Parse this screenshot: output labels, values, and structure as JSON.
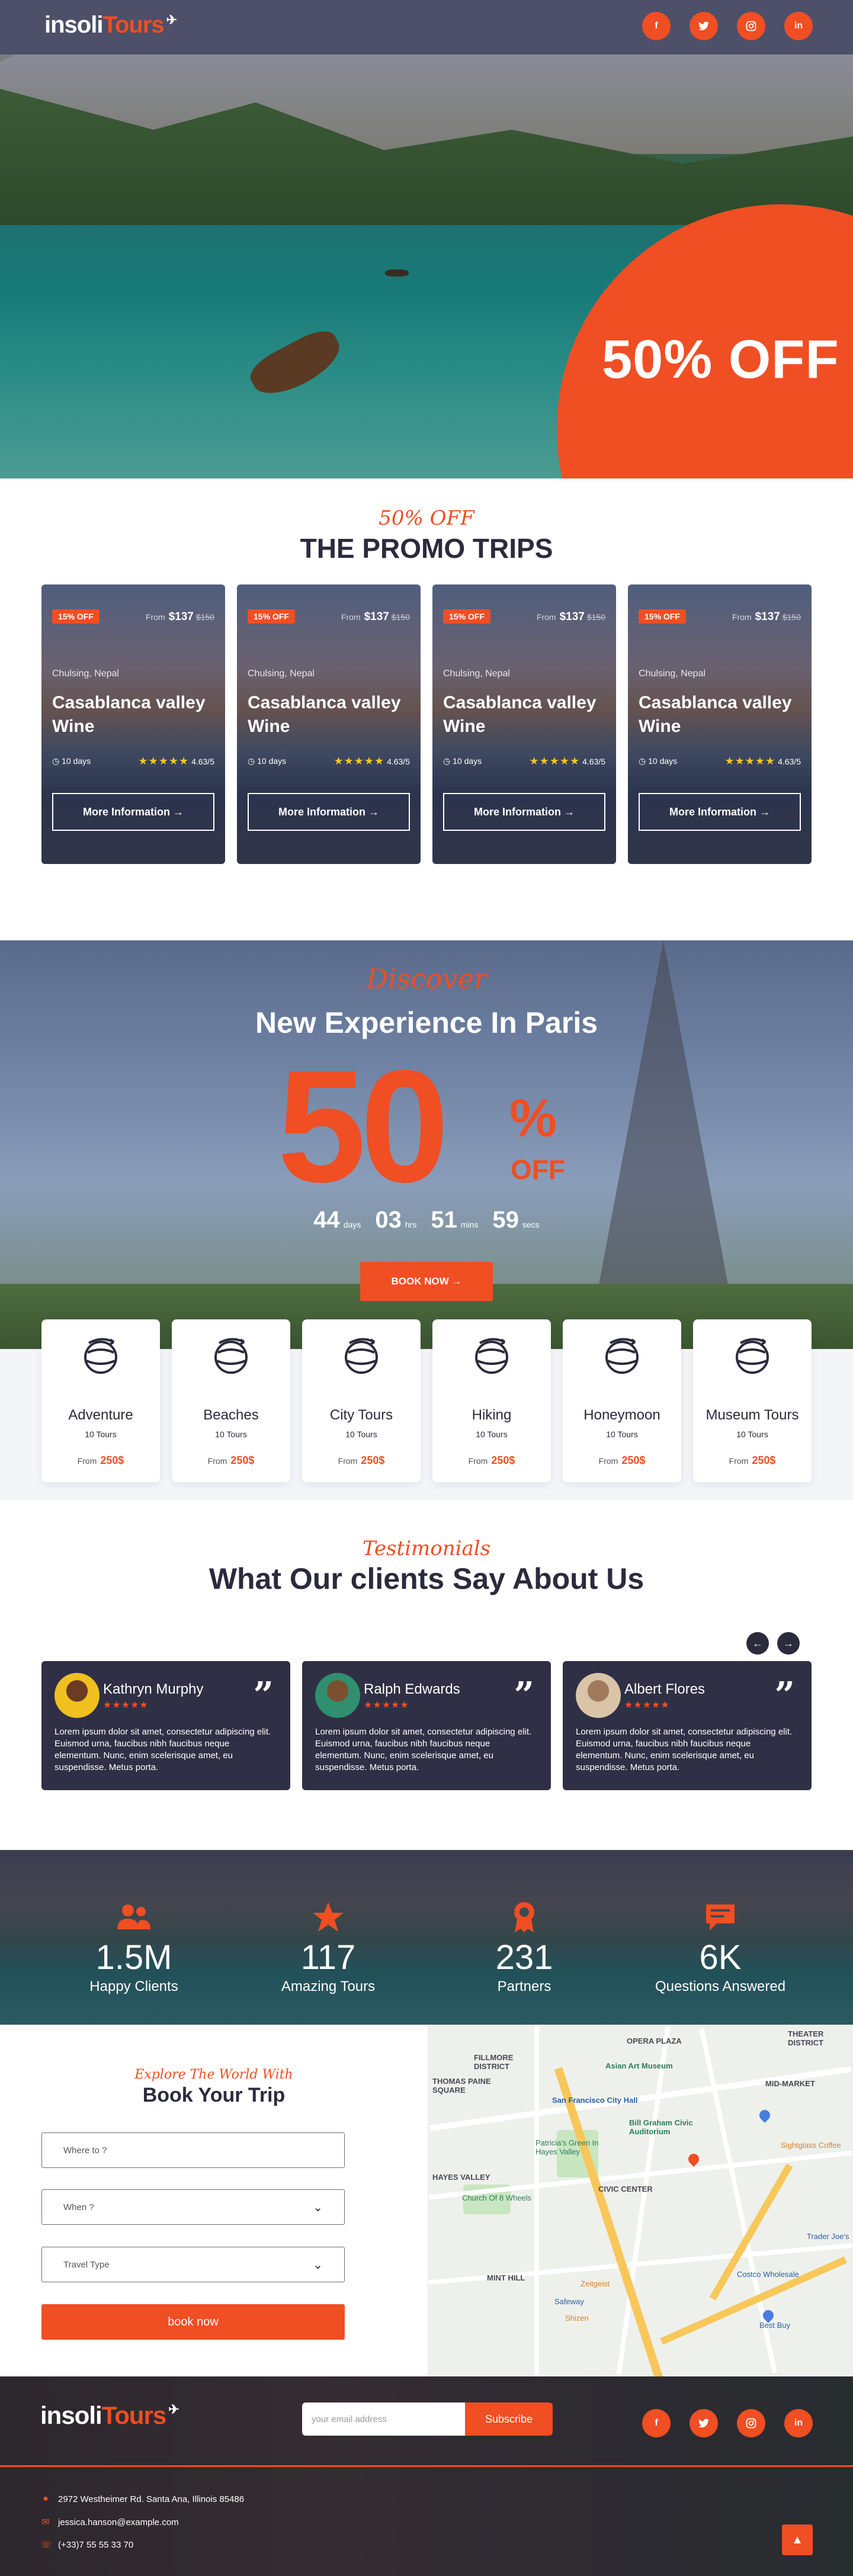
{
  "header": {
    "logo_part1": "insoli",
    "logo_part2": "Tours",
    "socials": [
      "f",
      "t",
      "ig",
      "in"
    ]
  },
  "hero": {
    "offer": "50% OFF"
  },
  "promo": {
    "script": "50% OFF",
    "title": "THE PROMO TRIPS",
    "cards": [
      {
        "badge": "15% OFF",
        "from": "From",
        "price": "$137",
        "old_price": "$150",
        "location": "Chulsing, Nepal",
        "title": "Casablanca valley Wine",
        "duration": "10 days",
        "rating": "4.63/5",
        "button": "More Information →"
      },
      {
        "badge": "15% OFF",
        "from": "From",
        "price": "$137",
        "old_price": "$150",
        "location": "Chulsing, Nepal",
        "title": "Casablanca valley Wine",
        "duration": "10 days",
        "rating": "4.63/5",
        "button": "More Information →"
      },
      {
        "badge": "15% OFF",
        "from": "From",
        "price": "$137",
        "old_price": "$150",
        "location": "Chulsing, Nepal",
        "title": "Casablanca valley Wine",
        "duration": "10 days",
        "rating": "4.63/5",
        "button": "More Information →"
      },
      {
        "badge": "15% OFF",
        "from": "From",
        "price": "$137",
        "old_price": "$150",
        "location": "Chulsing, Nepal",
        "title": "Casablanca valley Wine",
        "duration": "10 days",
        "rating": "4.63/5",
        "button": "More Information →"
      }
    ]
  },
  "paris": {
    "script": "Discover",
    "title": "New Experience In Paris",
    "big": "50",
    "pct": "%",
    "off": "OFF",
    "countdown": [
      {
        "n": "44",
        "u": "days"
      },
      {
        "n": "03",
        "u": "hrs"
      },
      {
        "n": "51",
        "u": "mins"
      },
      {
        "n": "59",
        "u": "secs"
      }
    ],
    "button": "BOOK NOW →"
  },
  "categories": [
    {
      "name": "Adventure",
      "tours": "10 Tours",
      "from": "From",
      "price": "250$"
    },
    {
      "name": "Beaches",
      "tours": "10 Tours",
      "from": "From",
      "price": "250$"
    },
    {
      "name": "City Tours",
      "tours": "10 Tours",
      "from": "From",
      "price": "250$"
    },
    {
      "name": "Hiking",
      "tours": "10 Tours",
      "from": "From",
      "price": "250$"
    },
    {
      "name": "Honeymoon",
      "tours": "10 Tours",
      "from": "From",
      "price": "250$"
    },
    {
      "name": "Museum Tours",
      "tours": "10 Tours",
      "from": "From",
      "price": "250$"
    }
  ],
  "testimonials": {
    "script": "Testimonials",
    "title": "What Our clients Say About Us",
    "items": [
      {
        "name": "Kathryn Murphy",
        "stars": "★★★★★",
        "text": "Lorem ipsum dolor sit amet, consectetur adipiscing elit. Euismod urna, faucibus nibh faucibus neque elementum. Nunc, enim scelerisque amet, eu suspendisse. Metus porta.",
        "color": "#f0c020"
      },
      {
        "name": "Ralph Edwards",
        "stars": "★★★★★",
        "text": "Lorem ipsum dolor sit amet, consectetur adipiscing elit. Euismod urna, faucibus nibh faucibus neque elementum. Nunc, enim scelerisque amet, eu suspendisse. Metus porta.",
        "color": "#2f8f6f"
      },
      {
        "name": "Albert Flores",
        "stars": "★★★★★",
        "text": "Lorem ipsum dolor sit amet, consectetur adipiscing elit. Euismod urna, faucibus nibh faucibus neque elementum. Nunc, enim scelerisque amet, eu suspendisse. Metus porta.",
        "color": "#d9c4a8"
      }
    ]
  },
  "stats": [
    {
      "value": "1.5M",
      "label": "Happy Clients",
      "icon": "users-icon"
    },
    {
      "value": "117",
      "label": "Amazing Tours",
      "icon": "star-icon"
    },
    {
      "value": "231",
      "label": "Partners",
      "icon": "award-icon"
    },
    {
      "value": "6K",
      "label": "Questions Answered",
      "icon": "chat-icon"
    }
  ],
  "booking": {
    "script": "Explore The World With",
    "title": "Book Your Trip",
    "where": "Where to ?",
    "when": "When ?",
    "type": "Travel Type",
    "button": "book now"
  },
  "map_labels": [
    "OPERA PLAZA",
    "Asian Art Museum",
    "MID-MARKET",
    "San Francisco City Hall",
    "Bill Graham Civic Auditorium",
    "CIVIC CENTER",
    "HAYES VALLEY",
    "Patricia's Green In Hayes Valley",
    "Church Of 8 Wheels",
    "Sightglass Coffee",
    "Zeitgeist",
    "Costco Wholesale",
    "Safeway",
    "Best Buy",
    "MINT HILL",
    "THEATER DISTRICT",
    "FILLMORE DISTRICT",
    "THOMAS PAINE SQUARE",
    "Trader Joe's",
    "Shizen"
  ],
  "footer": {
    "logo_part1": "insoli",
    "logo_part2": "Tours",
    "email_placeholder": "your email address",
    "subscribe": "Subscribe",
    "address": "2972 Westheimer Rd. Santa Ana, Illinois 85486",
    "email": "jessica.hanson@example.com",
    "phone": "(+33)7 55 55 33 70",
    "to_top": "▲"
  },
  "colors": {
    "accent": "#f04e23",
    "dark": "#2b2b3d",
    "card": "#2f3045"
  }
}
